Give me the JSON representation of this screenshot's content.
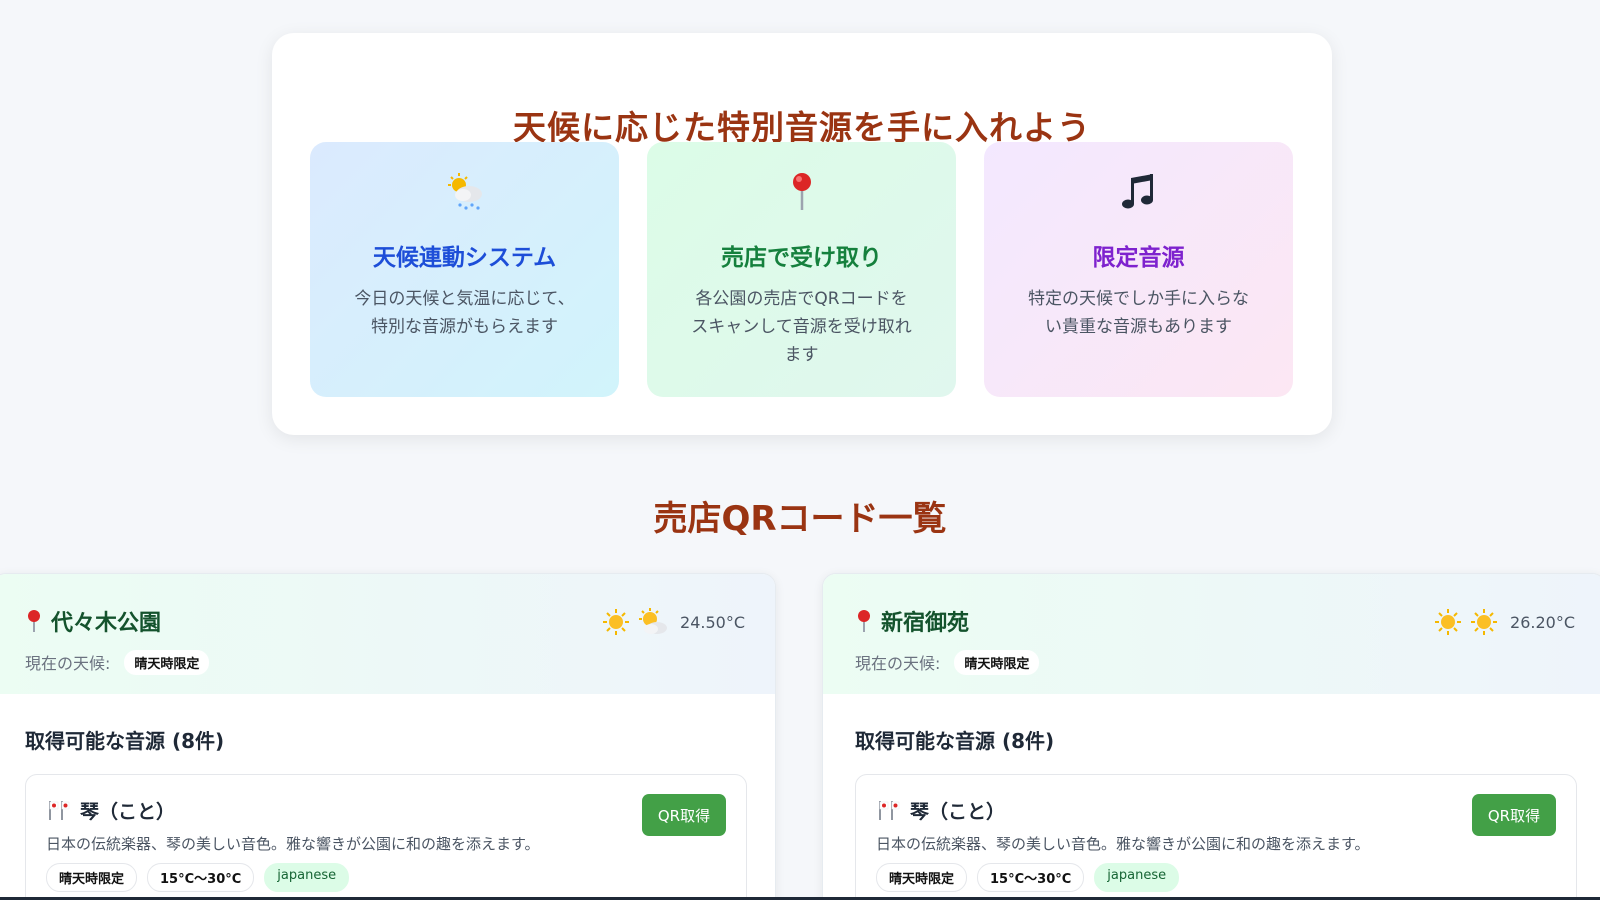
{
  "hero": {
    "title": "天候に応じた特別音源を手に入れよう",
    "features": [
      {
        "icon": "sun-behind-rain-cloud-icon",
        "title": "天候連動システム",
        "desc_lines": [
          "今日の天候と気温に応じて、",
          "特別な音源がもらえます"
        ]
      },
      {
        "icon": "map-pin-icon",
        "title": "売店で受け取り",
        "desc_lines": [
          "各公園の売店でQRコードを",
          "スキャンして音源を受け取れ",
          "ます"
        ]
      },
      {
        "icon": "musical-notes-icon",
        "title": "限定音源",
        "desc_lines": [
          "特定の天候でしか手に入らな",
          "い貴重な音源もあります"
        ]
      }
    ]
  },
  "section_title": "売店QRコード一覧",
  "shops": [
    {
      "name": "代々木公園",
      "weather_icons": [
        "sun-icon",
        "sun-behind-cloud-icon"
      ],
      "temperature": "24.50°C",
      "current_weather_label": "現在の天候:",
      "current_weather_badge": "晴天時限定",
      "available_title": "取得可能な音源 (8件)",
      "sound": {
        "name": "琴（こと）",
        "desc": "日本の伝統楽器、琴の美しい音色。雅な響きが公園に和の趣を添えます。",
        "button": "QR取得",
        "tags": [
          "晴天時限定",
          "15°C〜30°C",
          "japanese"
        ]
      }
    },
    {
      "name": "新宿御苑",
      "weather_icons": [
        "sun-icon",
        "sun-icon"
      ],
      "temperature": "26.20°C",
      "current_weather_label": "現在の天候:",
      "current_weather_badge": "晴天時限定",
      "available_title": "取得可能な音源 (8件)",
      "sound": {
        "name": "琴（こと）",
        "desc": "日本の伝統楽器、琴の美しい音色。雅な響きが公園に和の趣を添えます。",
        "button": "QR取得",
        "tags": [
          "晴天時限定",
          "15°C〜30°C",
          "japanese"
        ]
      }
    }
  ],
  "colors": {
    "heading": "#9a3412",
    "feature_blue": "#1d4ed8",
    "feature_green": "#15803d",
    "feature_purple": "#7e22ce",
    "button_green": "#43a047",
    "shop_name": "#14532d"
  }
}
